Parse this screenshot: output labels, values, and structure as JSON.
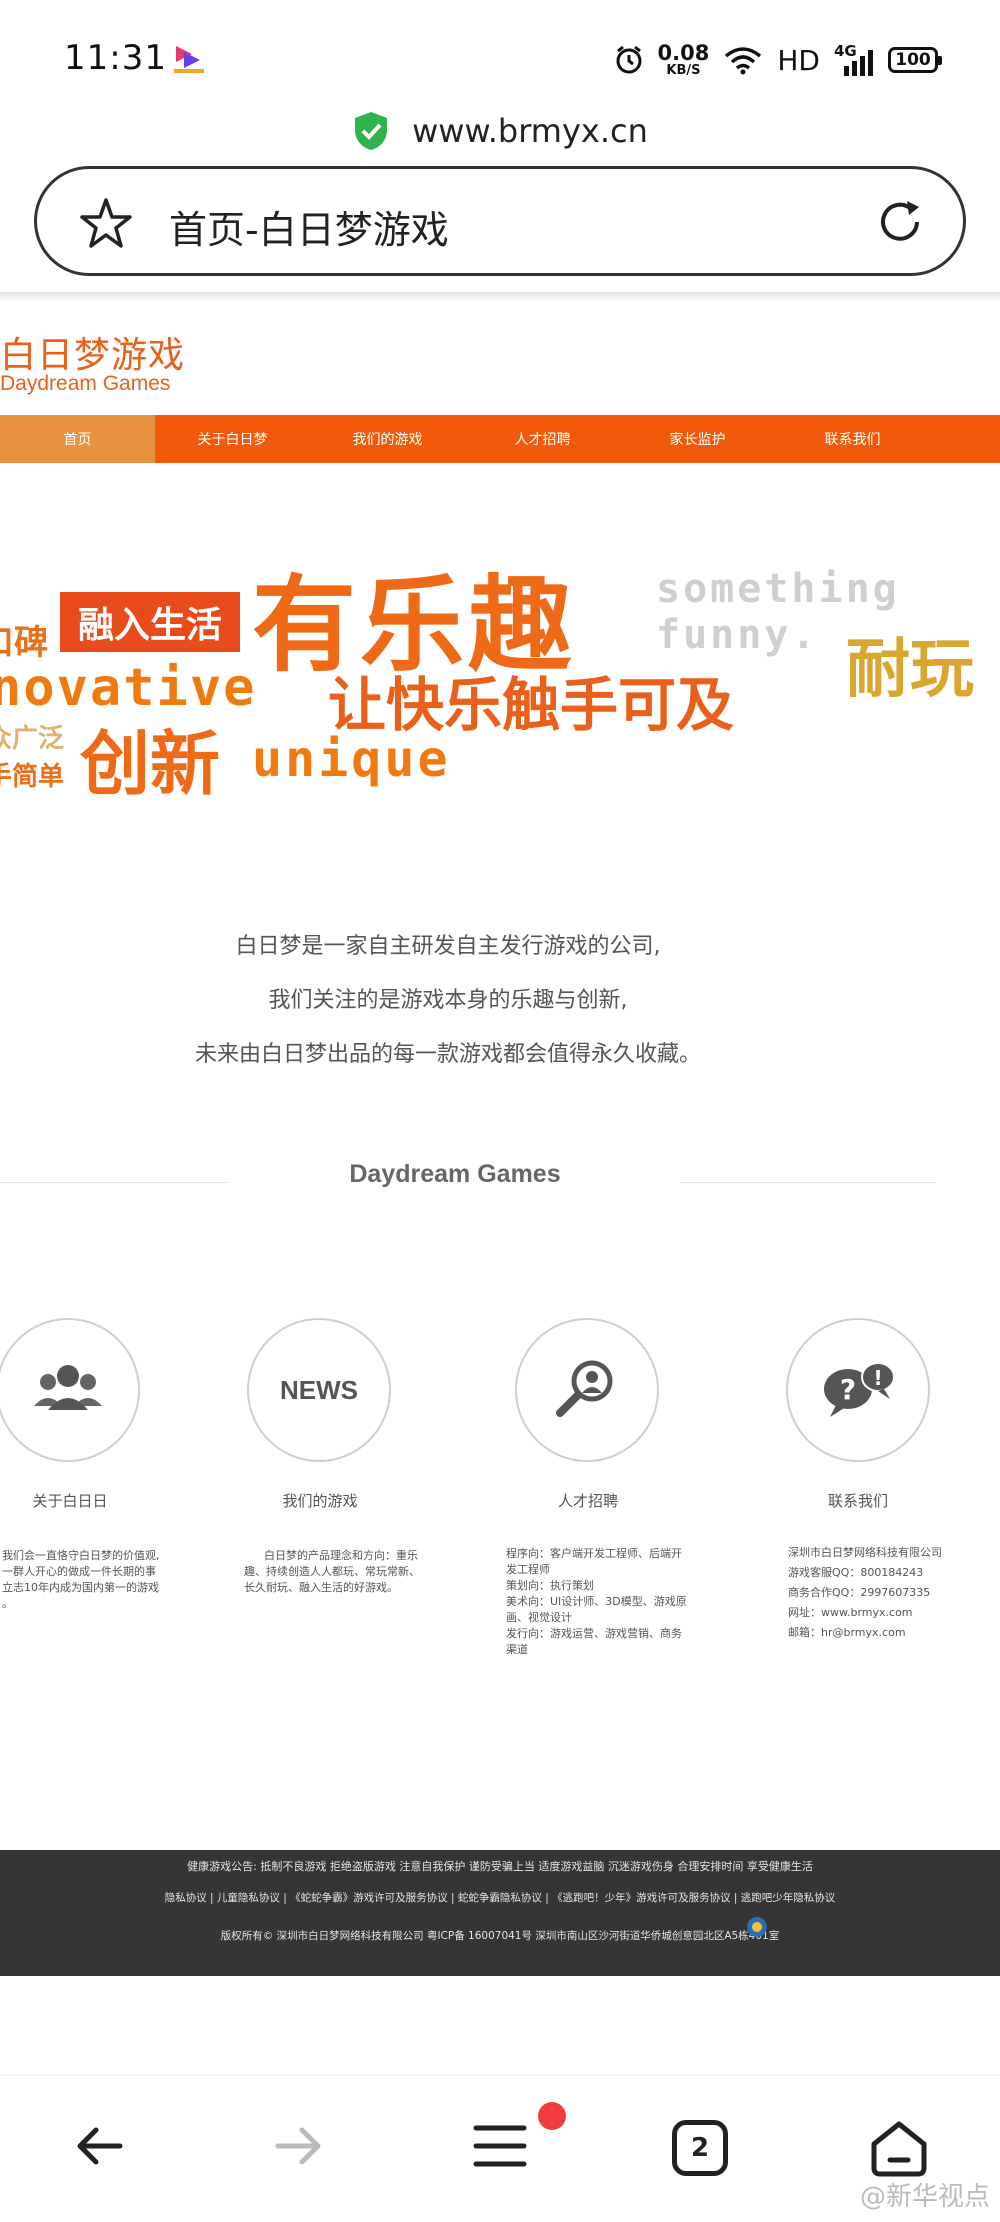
{
  "status_bar": {
    "time": "11:31",
    "net_speed_value": "0.08",
    "net_speed_unit": "KB/S",
    "hd": "HD",
    "signal": "4G",
    "battery": "100"
  },
  "browser": {
    "url": "www.brmyx.cn",
    "page_title": "首页-白日梦游戏",
    "tab_count": "2"
  },
  "site": {
    "logo_cn": "白日梦游戏",
    "logo_en": "Daydream Games",
    "nav": [
      {
        "label": "首页"
      },
      {
        "label": "关于白日梦"
      },
      {
        "label": "我们的游戏"
      },
      {
        "label": "人才招聘"
      },
      {
        "label": "家长监护"
      },
      {
        "label": "联系我们"
      }
    ],
    "banner": {
      "tag": "融入生活",
      "headline": "有乐趣",
      "en_1": "something",
      "en_2": "funny.",
      "sub": "让快乐触手可及",
      "side_right": "耐玩",
      "left_1": "口碑",
      "left_2": "novative",
      "left_3": "众广泛",
      "left_4": "手简单",
      "innov": "创新",
      "unique": "unique"
    },
    "intro": [
      "白日梦是一家自主研发自主发行游戏的公司,",
      "我们关注的是游戏本身的乐趣与创新,",
      "未来由白日梦出品的每一款游戏都会值得永久收藏。"
    ],
    "section_title": "Daydream  Games",
    "features": [
      {
        "icon": "people-group-icon",
        "label": "关于白日日",
        "desc": [
          "我们会一直恪守白日梦的价值观,",
          "一群人开心的做成一件长期的事",
          "立志10年内成为国内第一的游戏",
          "。"
        ]
      },
      {
        "icon": "news-icon",
        "icon_text": "NEWS",
        "label": "我们的游戏",
        "desc": [
          "白日梦的产品理念和方向：重乐",
          "趣、持续创造人人都玩、常玩常新、",
          "长久耐玩、融入生活的好游戏。"
        ]
      },
      {
        "icon": "recruit-magnifier-icon",
        "label": "人才招聘",
        "desc": [
          "程序向：客户端开发工程师、后端开",
          "发工程师",
          "策划向：执行策划",
          "美术向：UI设计师、3D模型、游戏原",
          "画、视觉设计",
          "发行向：游戏运营、游戏营销、商务",
          "渠道"
        ]
      },
      {
        "icon": "question-bubble-icon",
        "label": "联系我们",
        "desc": [
          "深圳市白日梦网络科技有限公司",
          "游戏客服QQ：800184243",
          "商务合作QQ：2997607335",
          "网址：www.brmyx.com",
          "邮箱：hr@brmyx.com"
        ]
      }
    ],
    "footer": {
      "row1": "健康游戏公告:  抵制不良游戏  拒绝盗版游戏  注意自我保护  谨防受骗上当  适度游戏益脑  沉迷游戏伤身  合理安排时间  享受健康生活",
      "row2": "隐私协议 | 儿童隐私协议 | 《蛇蛇争霸》游戏许可及服务协议 | 蛇蛇争霸隐私协议 | 《逃跑吧！少年》游戏许可及服务协议 | 逃跑吧少年隐私协议",
      "row3": "版权所有© 深圳市白日梦网络科技有限公司  粤ICP备 16007041号   深圳市南山区沙河街道华侨城创意园北区A5栋401室"
    }
  },
  "watermark": "@新华视点",
  "colors": {
    "brand_orange": "#f05a0a",
    "nav_active": "#e8923f",
    "footer_bg": "#353535",
    "badge_red": "#f03c3c"
  }
}
